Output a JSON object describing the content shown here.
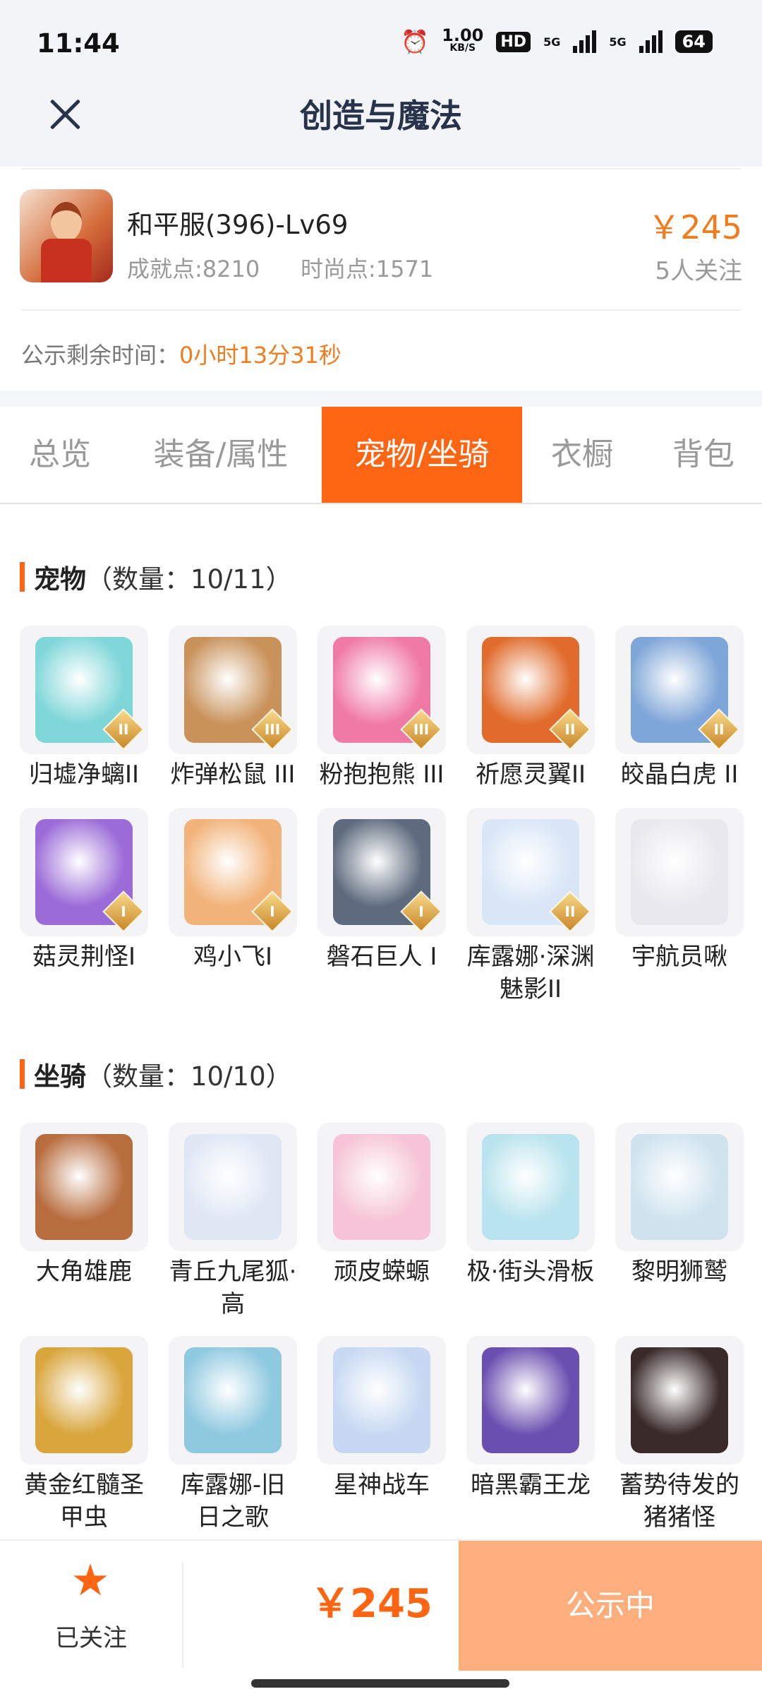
{
  "status_bar": {
    "time": "11:44",
    "speed_value": "1.00",
    "speed_unit": "KB/S",
    "hd": "HD",
    "net1": "5G",
    "net2": "5G",
    "battery": "64"
  },
  "nav": {
    "title": "创造与魔法"
  },
  "seller": {
    "name": "和平服(396)-Lv69",
    "achievement": "成就点:8210",
    "fashion": "时尚点:1571",
    "price": "￥245",
    "followers": "5人关注",
    "remain_label": "公示剩余时间：",
    "remain_value": "0小时13分31秒"
  },
  "tabs": [
    {
      "label": "总览"
    },
    {
      "label": "装备/属性"
    },
    {
      "label": "宠物/坐骑",
      "active": true
    },
    {
      "label": "衣橱"
    },
    {
      "label": "背包"
    }
  ],
  "pets": {
    "title": "宠物",
    "count": "（数量：10/11）",
    "items": [
      {
        "name": "归墟净螭II",
        "rank": "II",
        "color": "#7fd6d9"
      },
      {
        "name": "炸弹松鼠 III",
        "rank": "III",
        "color": "#c9925b"
      },
      {
        "name": "粉抱抱熊 III",
        "rank": "III",
        "color": "#f07aa6"
      },
      {
        "name": "祈愿灵翼II",
        "rank": "II",
        "color": "#e06b2c"
      },
      {
        "name": "皎晶白虎 II",
        "rank": "II",
        "color": "#7fa6d8"
      },
      {
        "name": "菇灵荆怪I",
        "rank": "I",
        "color": "#9b6bd8"
      },
      {
        "name": "鸡小飞I",
        "rank": "I",
        "color": "#f2b37a"
      },
      {
        "name": "磐石巨人 I",
        "rank": "I",
        "color": "#5e6b7e"
      },
      {
        "name": "库露娜·深渊魅影II",
        "rank": "II",
        "color": "#d8e6f7"
      },
      {
        "name": "宇航员啾",
        "rank": "",
        "color": "#e8e8ee"
      }
    ]
  },
  "mounts": {
    "title": "坐骑",
    "count": "（数量：10/10）",
    "items": [
      {
        "name": "大角雄鹿",
        "color": "#b86d3f"
      },
      {
        "name": "青丘九尾狐·高",
        "color": "#dfe7f5"
      },
      {
        "name": "顽皮蝾螈",
        "color": "#f6c4d6"
      },
      {
        "name": "极·街头滑板",
        "color": "#b9e3ee"
      },
      {
        "name": "黎明狮鹫",
        "color": "#cfe3ef"
      },
      {
        "name": "黄金红髓圣甲虫",
        "color": "#d9a63d"
      },
      {
        "name": "库露娜-旧日之歌",
        "color": "#8fc9e0"
      },
      {
        "name": "星神战车",
        "color": "#c7d9f2"
      },
      {
        "name": "暗黑霸王龙",
        "color": "#6b4fb0"
      },
      {
        "name": "蓄势待发的猪猪怪",
        "color": "#3a2a2a"
      }
    ]
  },
  "bottom": {
    "star": "★",
    "fav_label": "已关注",
    "price": "￥245",
    "status": "公示中"
  },
  "colors": {
    "accent": "#fe6512",
    "price": "#f07c1e"
  }
}
